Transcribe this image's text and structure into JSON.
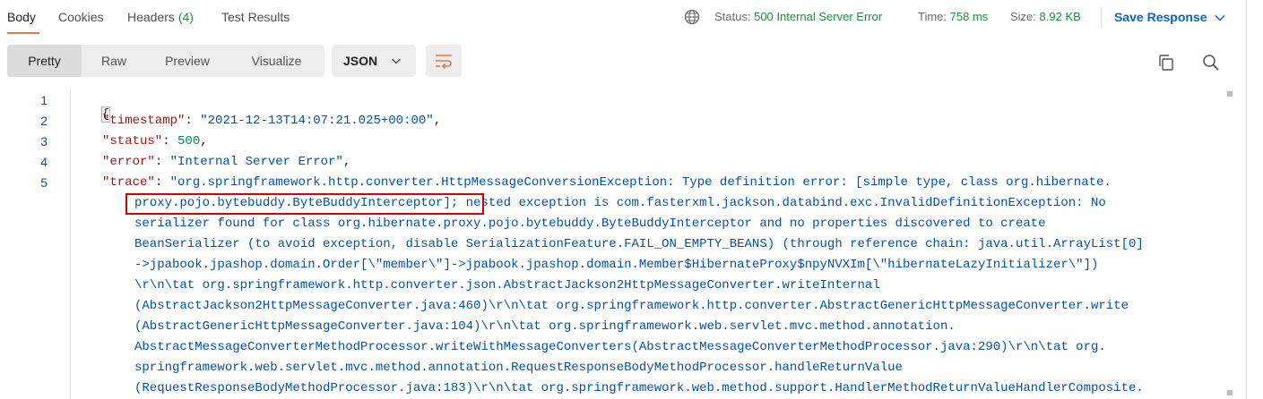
{
  "tabs": [
    {
      "label": "Body",
      "count": ""
    },
    {
      "label": "Cookies",
      "count": ""
    },
    {
      "label": "Headers",
      "count": "(4)"
    },
    {
      "label": "Test Results",
      "count": ""
    }
  ],
  "status": {
    "status_label": "Status:",
    "status_value": "500 Internal Server Error",
    "time_label": "Time:",
    "time_value": "758 ms",
    "size_label": "Size:",
    "size_value": "8.92 KB"
  },
  "save_response": "Save Response",
  "view_modes": [
    "Pretty",
    "Raw",
    "Preview",
    "Visualize"
  ],
  "format_select": "JSON",
  "icons": {
    "globe": "globe-icon",
    "wrap": "wrap-lines-icon",
    "copy": "copy-icon",
    "search": "search-icon",
    "chevron": "chevron-down-icon"
  },
  "colors": {
    "accent": "#e07b48",
    "status_ok": "#1e8e3e",
    "link": "#0b63ce",
    "highlight": "#d40000"
  },
  "code": {
    "line_numbers": [
      "1",
      "2",
      "3",
      "4",
      "5"
    ],
    "open_brace": "{",
    "timestamp_key": "\"timestamp\"",
    "timestamp_val": "\"2021-12-13T14:07:21.025+00:00\"",
    "status_key": "\"status\"",
    "status_val": "500",
    "error_key": "\"error\"",
    "error_val": "\"Internal Server Error\"",
    "trace_key": "\"trace\"",
    "trace_lines": [
      "\"org.springframework.http.converter.HttpMessageConversionException: Type definition error: [simple type, class org.hibernate.",
      "proxy.pojo.bytebuddy.ByteBuddyInterceptor]; nested exception is com.fasterxml.jackson.databind.exc.InvalidDefinitionException: No",
      "serializer found for class org.hibernate.proxy.pojo.bytebuddy.ByteBuddyInterceptor and no properties discovered to create",
      "BeanSerializer (to avoid exception, disable SerializationFeature.FAIL_ON_EMPTY_BEANS) (through reference chain: java.util.ArrayList[0]",
      "->jpabook.jpashop.domain.Order[\\\"member\\\"]->jpabook.jpashop.domain.Member$HibernateProxy$npyNVXIm[\\\"hibernateLazyInitializer\\\"])",
      "\\r\\n\\tat org.springframework.http.converter.json.AbstractJackson2HttpMessageConverter.writeInternal",
      "(AbstractJackson2HttpMessageConverter.java:460)\\r\\n\\tat org.springframework.http.converter.AbstractGenericHttpMessageConverter.write",
      "(AbstractGenericHttpMessageConverter.java:104)\\r\\n\\tat org.springframework.web.servlet.mvc.method.annotation.",
      "AbstractMessageConverterMethodProcessor.writeWithMessageConverters(AbstractMessageConverterMethodProcessor.java:290)\\r\\n\\tat org.",
      "springframework.web.servlet.mvc.method.annotation.RequestResponseBodyMethodProcessor.handleReturnValue",
      "(RequestResponseBodyMethodProcessor.java:183)\\r\\n\\tat org.springframework.web.method.support.HandlerMethodReturnValueHandlerComposite."
    ]
  }
}
